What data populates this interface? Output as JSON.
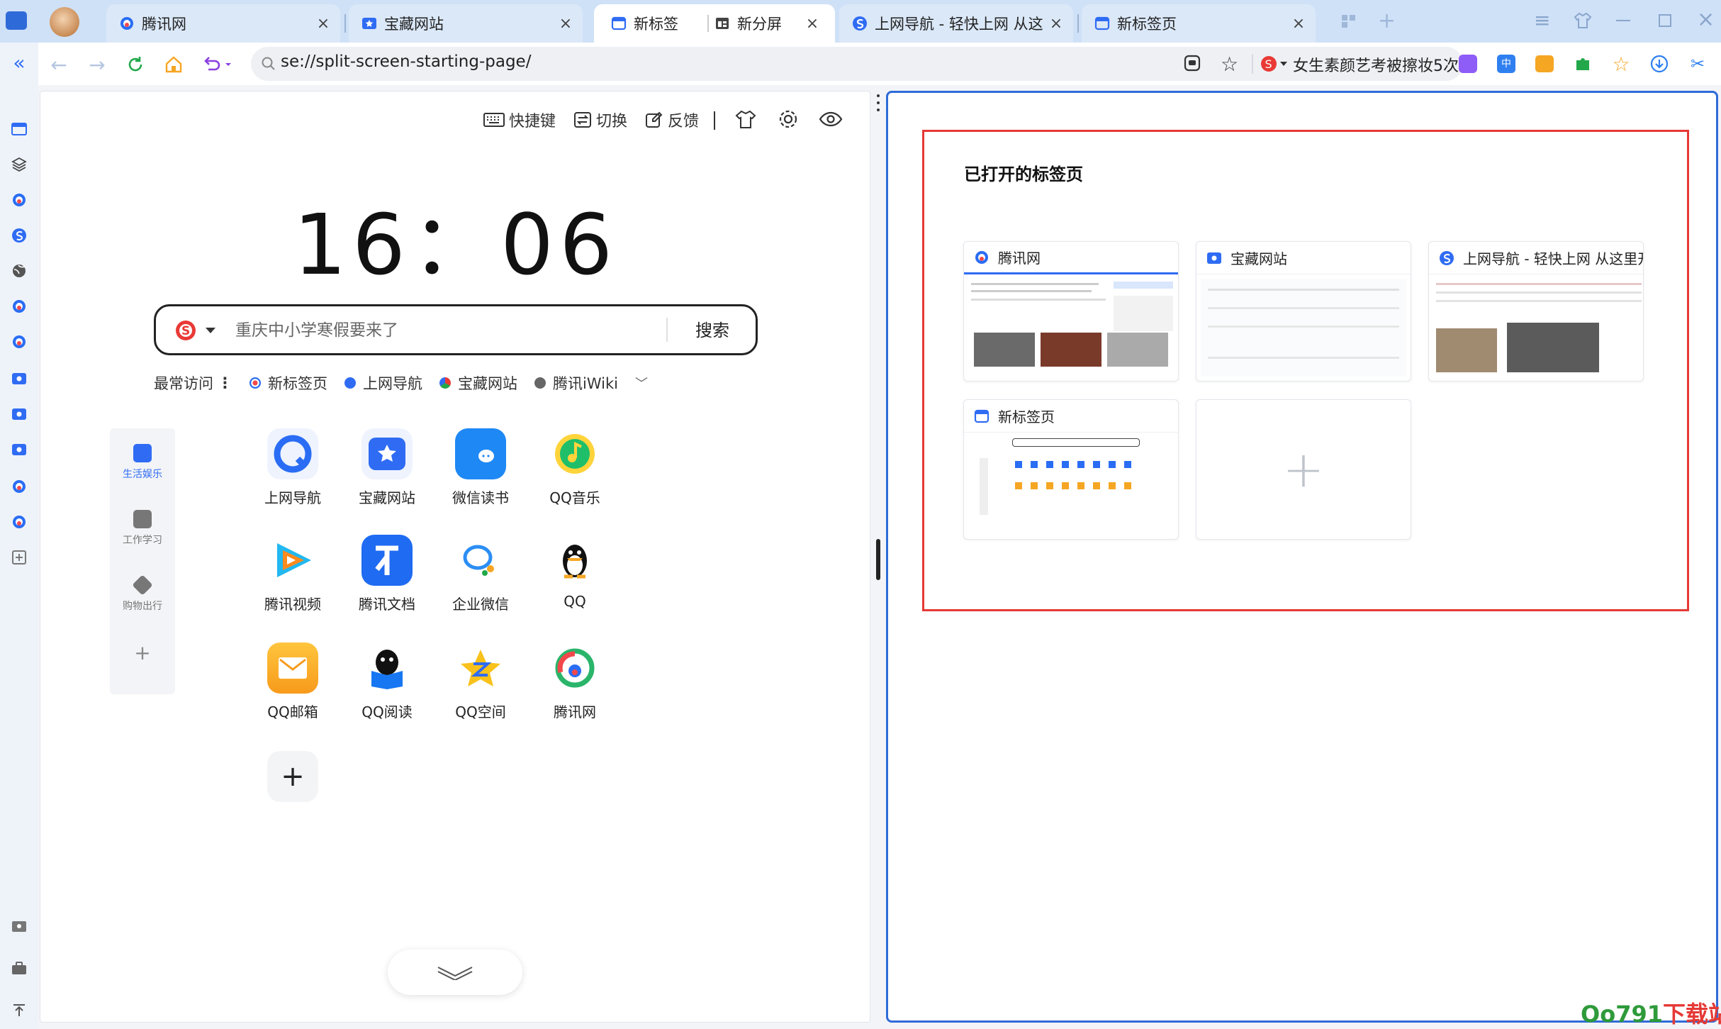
{
  "tabs": [
    {
      "label": "腾讯网",
      "icon": "tencent-icon",
      "active": false
    },
    {
      "label": "宝藏网站",
      "icon": "bookmark-folder-icon",
      "active": false
    },
    {
      "label": "新标签",
      "icon": "new-tab-icon",
      "active": true
    },
    {
      "label": "新分屏",
      "icon": "split-screen-icon",
      "active": true
    },
    {
      "label": "上网导航 - 轻快上网 从这里开",
      "icon": "sogou-nav-icon",
      "active": false
    },
    {
      "label": "新标签页",
      "icon": "new-tab-icon",
      "active": false
    }
  ],
  "address": {
    "url": "se://split-screen-starting-page/",
    "hot_search": "女生素颜艺考被擦妆5次"
  },
  "left": {
    "tools": {
      "shortcuts": "快捷键",
      "switch": "切换",
      "feedback": "反馈"
    },
    "clock": "16：06",
    "search": {
      "placeholder": "重庆中小学寒假要来了",
      "button": "搜索"
    },
    "frequent": {
      "label": "最常访问",
      "items": [
        "新标签页",
        "上网导航",
        "宝藏网站",
        "腾讯iWiki"
      ]
    },
    "categories": [
      {
        "label": "生活娱乐",
        "active": true
      },
      {
        "label": "工作学习",
        "active": false
      },
      {
        "label": "购物出行",
        "active": false
      }
    ],
    "apps": [
      {
        "label": "上网导航",
        "color": "#2a6df4"
      },
      {
        "label": "宝藏网站",
        "color": "#2f6cf3"
      },
      {
        "label": "微信读书",
        "color": "#1e88f5"
      },
      {
        "label": "QQ音乐",
        "color": "#ffd43b"
      },
      {
        "label": "腾讯视频",
        "color": "#22b8f0"
      },
      {
        "label": "腾讯文档",
        "color": "#1f6bf2"
      },
      {
        "label": "企业微信",
        "color": "#2b8ef4"
      },
      {
        "label": "QQ",
        "color": "#111111"
      },
      {
        "label": "QQ邮箱",
        "color": "#f8a81d"
      },
      {
        "label": "QQ阅读",
        "color": "#1777f2"
      },
      {
        "label": "QQ空间",
        "color": "#f9c21b"
      },
      {
        "label": "腾讯网",
        "color": "#2ab56a"
      }
    ]
  },
  "right": {
    "title": "已打开的标签页",
    "cards": [
      {
        "label": "腾讯网",
        "icon": "tencent-icon"
      },
      {
        "label": "宝藏网站",
        "icon": "bookmark-folder-icon"
      },
      {
        "label": "上网导航 - 轻快上网 从这里开",
        "icon": "sogou-nav-icon"
      },
      {
        "label": "新标签页",
        "icon": "new-tab-icon"
      }
    ]
  },
  "watermark": {
    "part1": "Oo791",
    "part2": "下载站"
  }
}
